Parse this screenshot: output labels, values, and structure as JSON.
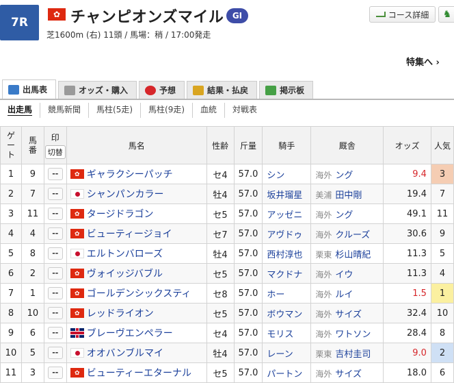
{
  "race": {
    "number": "7R",
    "name": "チャンピオンズマイル",
    "grade": "GI",
    "info": "芝1600m (右) 11頭 / 馬場：稍 / 17:00発走"
  },
  "header": {
    "course_button": "コース詳細",
    "special_link": "特集へ ›"
  },
  "tabs": [
    {
      "label": "出馬表",
      "icon": "table-icon",
      "color": "#3a7bc8"
    },
    {
      "label": "オッズ・購入",
      "icon": "odds-icon",
      "color": "#9a9a9a"
    },
    {
      "label": "予想",
      "icon": "target-icon",
      "color": "#d6262a"
    },
    {
      "label": "結果・払戻",
      "icon": "coins-icon",
      "color": "#d9a521"
    },
    {
      "label": "掲示板",
      "icon": "chat-icon",
      "color": "#46a046"
    }
  ],
  "subnav": [
    "出走馬",
    "競馬新聞",
    "馬柱(5走)",
    "馬柱(9走)",
    "血統",
    "対戦表"
  ],
  "table": {
    "headers": {
      "gate": "ゲート",
      "num": "馬番",
      "mark": "印",
      "mark_toggle": "切替",
      "horse": "馬名",
      "sexage": "性齢",
      "weight": "斤量",
      "jockey": "騎手",
      "trainer": "厩舎",
      "odds": "オッズ",
      "pop": "人気"
    },
    "mark_default": "--",
    "rows": [
      {
        "gate": "1",
        "num": "9",
        "flag": "hk",
        "horse": "ギャラクシーパッチ",
        "sexage": "セ4",
        "weight": "57.0",
        "jockey": "シン",
        "region": "海外",
        "trainer": "ング",
        "odds": "9.4",
        "odds_hot": true,
        "pop": "3",
        "rank": 3
      },
      {
        "gate": "2",
        "num": "7",
        "flag": "jp",
        "horse": "シャンパンカラー",
        "sexage": "牡4",
        "weight": "57.0",
        "jockey": "坂井瑠星",
        "region": "美浦",
        "trainer": "田中剛",
        "odds": "19.4",
        "odds_hot": false,
        "pop": "7",
        "rank": 0
      },
      {
        "gate": "3",
        "num": "11",
        "flag": "hk",
        "horse": "タージドラゴン",
        "sexage": "セ5",
        "weight": "57.0",
        "jockey": "アッゼニ",
        "region": "海外",
        "trainer": "ング",
        "odds": "49.1",
        "odds_hot": false,
        "pop": "11",
        "rank": 0
      },
      {
        "gate": "4",
        "num": "4",
        "flag": "hk",
        "horse": "ビューティージョイ",
        "sexage": "セ7",
        "weight": "57.0",
        "jockey": "アヴドゥ",
        "region": "海外",
        "trainer": "クルーズ",
        "odds": "30.6",
        "odds_hot": false,
        "pop": "9",
        "rank": 0
      },
      {
        "gate": "5",
        "num": "8",
        "flag": "jp",
        "horse": "エルトンバローズ",
        "sexage": "牡4",
        "weight": "57.0",
        "jockey": "西村淳也",
        "region": "栗東",
        "trainer": "杉山晴紀",
        "odds": "11.3",
        "odds_hot": false,
        "pop": "5",
        "rank": 0
      },
      {
        "gate": "6",
        "num": "2",
        "flag": "hk",
        "horse": "ヴォイッジバブル",
        "sexage": "セ5",
        "weight": "57.0",
        "jockey": "マクドナ",
        "region": "海外",
        "trainer": "イウ",
        "odds": "11.3",
        "odds_hot": false,
        "pop": "4",
        "rank": 0
      },
      {
        "gate": "7",
        "num": "1",
        "flag": "hk",
        "horse": "ゴールデンシックスティ",
        "sexage": "セ8",
        "weight": "57.0",
        "jockey": "ホー",
        "region": "海外",
        "trainer": "ルイ",
        "odds": "1.5",
        "odds_hot": true,
        "pop": "1",
        "rank": 1
      },
      {
        "gate": "8",
        "num": "10",
        "flag": "hk",
        "horse": "レッドライオン",
        "sexage": "セ5",
        "weight": "57.0",
        "jockey": "ボウマン",
        "region": "海外",
        "trainer": "サイズ",
        "odds": "32.4",
        "odds_hot": false,
        "pop": "10",
        "rank": 0
      },
      {
        "gate": "9",
        "num": "6",
        "flag": "gb",
        "horse": "ブレーヴエンペラー",
        "sexage": "セ4",
        "weight": "57.0",
        "jockey": "モリス",
        "region": "海外",
        "trainer": "ワトソン",
        "odds": "28.4",
        "odds_hot": false,
        "pop": "8",
        "rank": 0
      },
      {
        "gate": "10",
        "num": "5",
        "flag": "jp",
        "horse": "オオバンブルマイ",
        "sexage": "牡4",
        "weight": "57.0",
        "jockey": "レーン",
        "region": "栗東",
        "trainer": "吉村圭司",
        "odds": "9.0",
        "odds_hot": true,
        "pop": "2",
        "rank": 2
      },
      {
        "gate": "11",
        "num": "3",
        "flag": "hk",
        "horse": "ビューティーエターナル",
        "sexage": "セ5",
        "weight": "57.0",
        "jockey": "パートン",
        "region": "海外",
        "trainer": "サイズ",
        "odds": "18.0",
        "odds_hot": false,
        "pop": "6",
        "rank": 0
      }
    ]
  }
}
